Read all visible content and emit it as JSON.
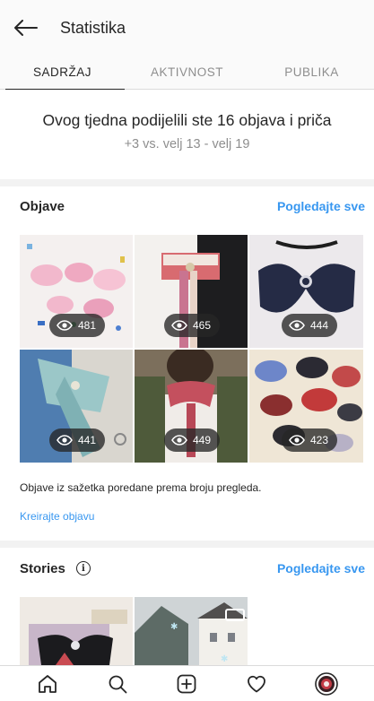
{
  "header": {
    "title": "Statistika",
    "back_icon": "arrow-left-icon"
  },
  "tabs": [
    {
      "label": "SADRŽAJ",
      "active": true
    },
    {
      "label": "AKTIVNOST",
      "active": false
    },
    {
      "label": "PUBLIKA",
      "active": false
    }
  ],
  "summary": {
    "headline": "Ovog tjedna podijelili ste 16 objava i priča",
    "comparison": "+3 vs. velj 13 - velj 19"
  },
  "posts": {
    "title": "Objave",
    "see_all": "Pogledajte sve",
    "items": [
      {
        "views": "481"
      },
      {
        "views": "465"
      },
      {
        "views": "444"
      },
      {
        "views": "441"
      },
      {
        "views": "449"
      },
      {
        "views": "423"
      }
    ],
    "note": "Objave iz sažetka poredane prema broju pregleda.",
    "create": "Kreirajte objavu"
  },
  "stories": {
    "title": "Stories",
    "see_all": "Pogledajte sve",
    "info_icon": "info-icon"
  },
  "bottom_nav": [
    {
      "icon": "home-icon"
    },
    {
      "icon": "search-icon"
    },
    {
      "icon": "add-post-icon"
    },
    {
      "icon": "heart-icon"
    },
    {
      "icon": "profile-avatar-icon"
    }
  ],
  "colors": {
    "link": "#3897f0",
    "text": "#262626",
    "muted": "#8e8e8e",
    "separator": "#f2f2f2"
  }
}
